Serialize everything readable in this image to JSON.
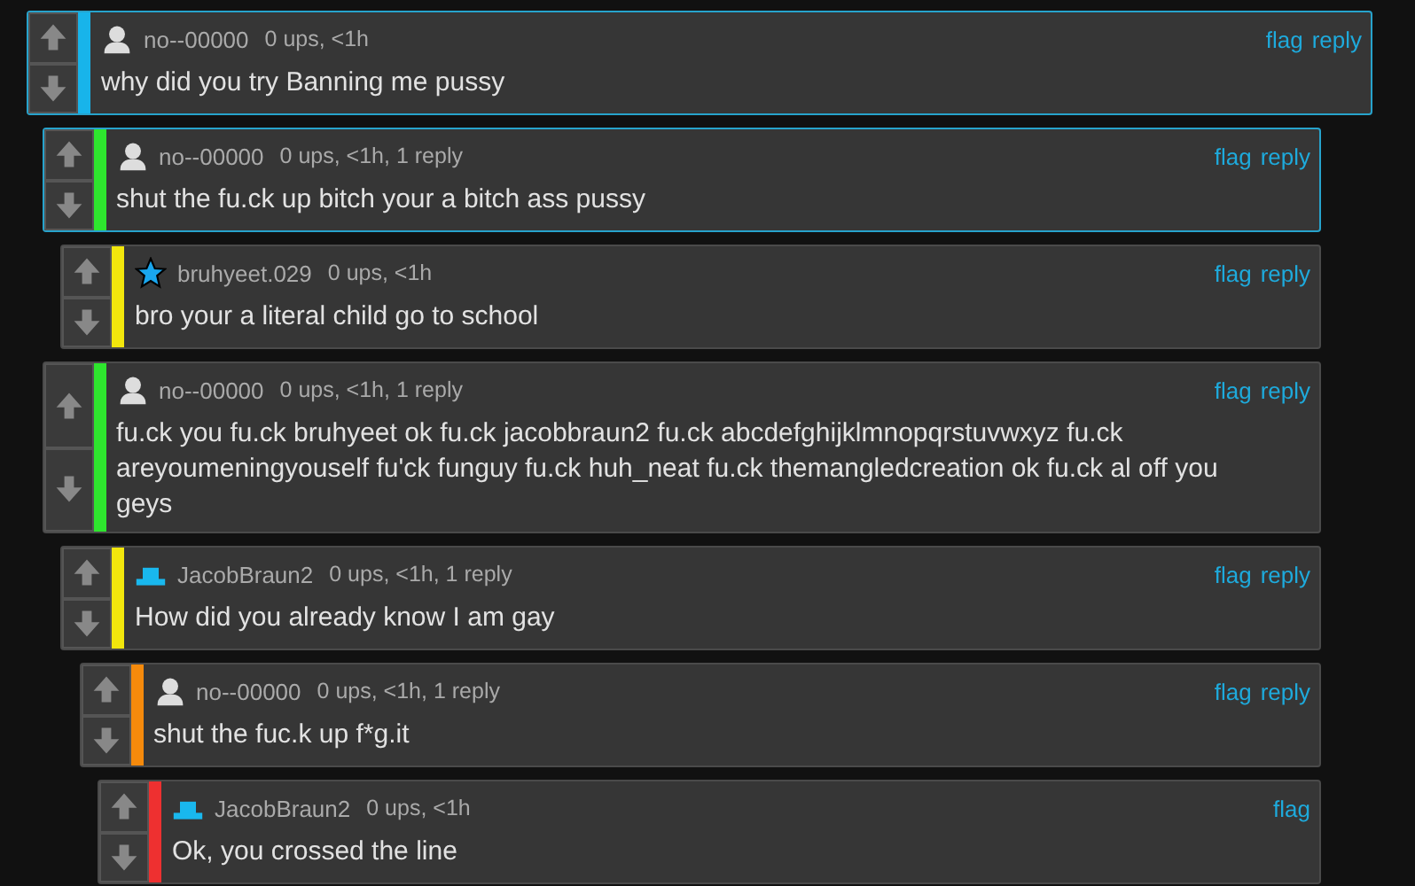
{
  "comments": [
    {
      "kind": "person",
      "username": "no--00000",
      "meta": "0 ups, <1h",
      "color": "#18b4ea",
      "highlighted": true,
      "actions": [
        "flag",
        "reply"
      ],
      "text": "why did you try Banning me pussy",
      "children": [
        {
          "kind": "person",
          "username": "no--00000",
          "meta": "0 ups, <1h, 1 reply",
          "color": "#2ee62e",
          "highlighted": true,
          "actions": [
            "flag",
            "reply"
          ],
          "text": "shut the fu.ck up bitch your a bitch ass pussy",
          "children": [
            {
              "kind": "star",
              "username": "bruhyeet.029",
              "meta": "0 ups, <1h",
              "color": "#f2e60c",
              "highlighted": false,
              "actions": [
                "flag",
                "reply"
              ],
              "text": "bro your a literal child go to school"
            }
          ]
        },
        {
          "kind": "person",
          "username": "no--00000",
          "meta": "0 ups, <1h, 1 reply",
          "color": "#2ee62e",
          "highlighted": false,
          "actions": [
            "flag",
            "reply"
          ],
          "text": "fu.ck you fu.ck bruhyeet ok fu.ck jacobbraun2 fu.ck abcdefghijklmnopqrstuvwxyz fu.ck areyoumeningyouself fu'ck funguy fu.ck huh_neat fu.ck themangledcreation ok fu.ck al off you geys",
          "children": [
            {
              "kind": "hat",
              "username": "JacobBraun2",
              "meta": "0 ups, <1h, 1 reply",
              "color": "#f2e60c",
              "highlighted": false,
              "actions": [
                "flag",
                "reply"
              ],
              "text": "How did you already know I am gay",
              "children": [
                {
                  "kind": "person",
                  "username": "no--00000",
                  "meta": "0 ups, <1h, 1 reply",
                  "color": "#f58a0c",
                  "highlighted": false,
                  "actions": [
                    "flag",
                    "reply"
                  ],
                  "text": "shut the fuc.k up f*g.it",
                  "children": [
                    {
                      "kind": "hat",
                      "username": "JacobBraun2",
                      "meta": "0 ups, <1h",
                      "color": "#ee3030",
                      "highlighted": false,
                      "actions": [
                        "flag"
                      ],
                      "text": "Ok, you crossed the line"
                    }
                  ]
                }
              ]
            }
          ]
        }
      ]
    }
  ]
}
